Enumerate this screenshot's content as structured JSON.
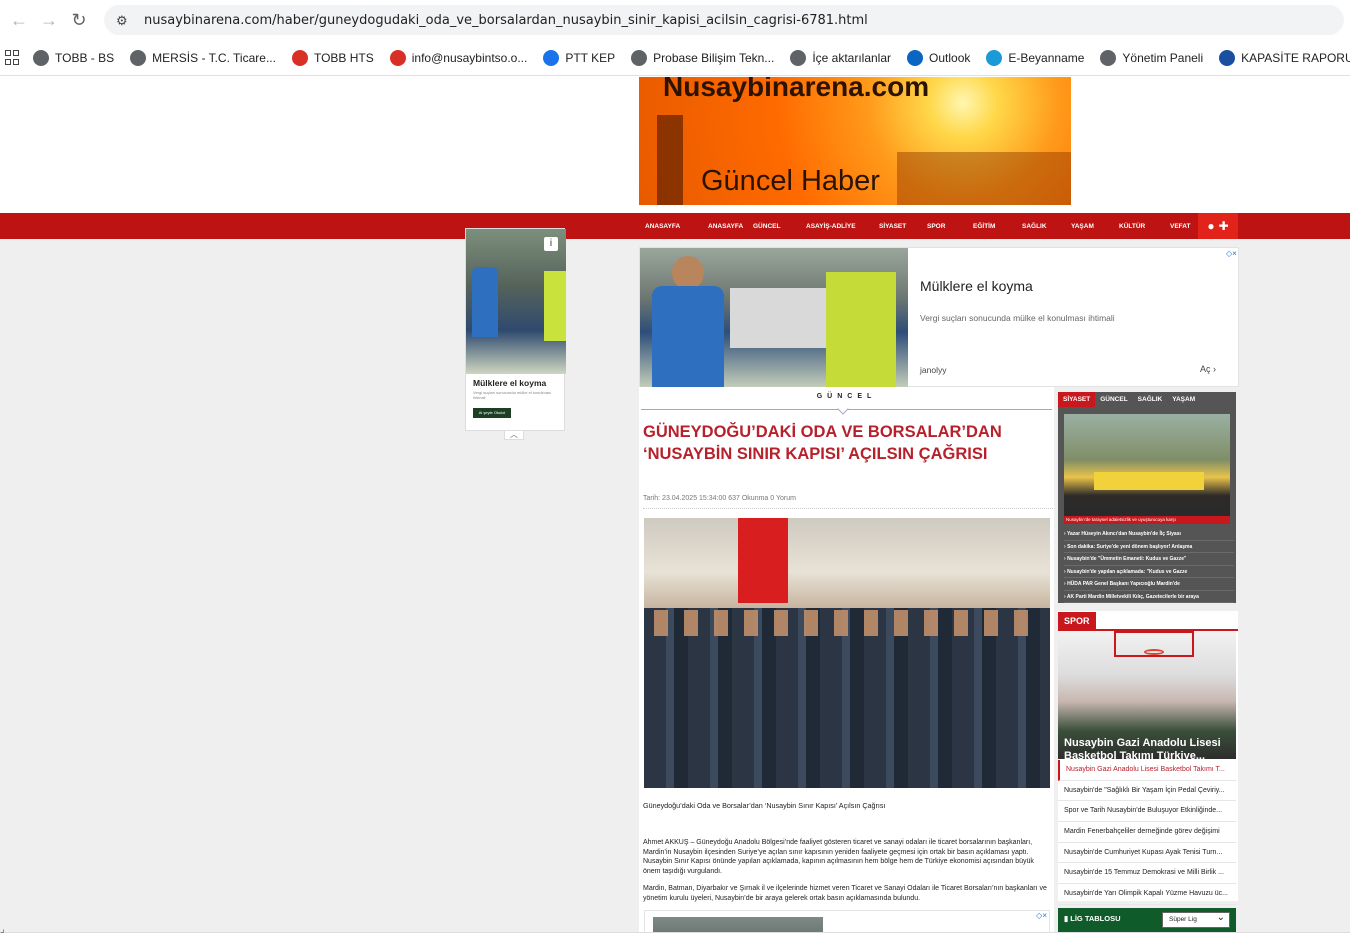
{
  "browser": {
    "url": "nusaybinarena.com/haber/guneydogudaki_oda_ve_borsalardan_nusaybin_sinir_kapisi_acilsin_cagrisi-6781.html",
    "bookmarks": [
      {
        "label": "TOBB - BS",
        "icon": "globe-icon",
        "color": "#5f6368"
      },
      {
        "label": "MERSİS - T.C. Ticare...",
        "icon": "globe-icon",
        "color": "#5f6368"
      },
      {
        "label": "TOBB HTS",
        "icon": "tobb-icon",
        "color": "#d93025"
      },
      {
        "label": "info@nusaybintso.o...",
        "icon": "mail-icon",
        "color": "#d93025"
      },
      {
        "label": "PTT KEP",
        "icon": "kep-icon",
        "color": "#1a73e8"
      },
      {
        "label": "Probase Bilişim Tekn...",
        "icon": "globe-icon",
        "color": "#5f6368"
      },
      {
        "label": "İçe aktarılanlar",
        "icon": "folder-icon",
        "color": "#5f6368"
      },
      {
        "label": "Outlook",
        "icon": "outlook-icon",
        "color": "#0a66c2"
      },
      {
        "label": "E-Beyanname",
        "icon": "ebeyan-icon",
        "color": "#1a9ad6"
      },
      {
        "label": "Yönetim Paneli",
        "icon": "globe-icon",
        "color": "#5f6368"
      },
      {
        "label": "KAPASİTE RAPORU...",
        "icon": "kapasite-icon",
        "color": "#1a4fa0"
      }
    ]
  },
  "site": {
    "banner_title": "Nusaybinarena.com",
    "banner_subtitle": "Güncel Haber",
    "menu": [
      "ANASAYFA",
      "ANASAYFA",
      "GÜNCEL",
      "ASAYİŞ-ADLİYE",
      "SİYASET",
      "SPOR",
      "EĞİTİM",
      "SAĞLIK",
      "YAŞAM",
      "KÜLTÜR",
      "VEFAT"
    ]
  },
  "left_ad": {
    "title": "Mülklere el koyma",
    "desc": "Vergi suçları sonucunda mülke el konulması ihtimali",
    "button": "Al şeyle Okulol"
  },
  "top_ad": {
    "title": "Mülklere el koyma",
    "desc": "Vergi suçları sonucunda mülke el konulması ihtimali",
    "domain": "janolyy",
    "open": "Aç"
  },
  "article": {
    "category": "GÜNCEL",
    "headline": "GÜNEYDOĞU’DAKİ ODA VE BORSALAR’DAN ‘NUSAYBİN SINIR KAPISI’ AÇILSIN ÇAĞRISI",
    "meta": "Tarih: 23.04.2025 15:34:00 637 Okunma 0 Yorum",
    "caption": "Güneydoğu’daki Oda ve Borsalar’dan ‘Nusaybin Sınır Kapısı’ Açılsın Çağrısı",
    "body1": "Ahmet AKKUŞ – Güneydoğu Anadolu Bölgesi’nde faaliyet gösteren ticaret ve sanayi odaları ile ticaret borsalarının başkanları, Mardin’in Nusaybin ilçesinden Suriye’ye açılan sınır kapısının yeniden faaliyete geçmesi için ortak bir basın açıklaması yaptı. Nusaybin Sınır Kapısı önünde yapılan açıklamada, kapının açılmasının hem bölge hem de Türkiye ekonomisi açısından büyük önem taşıdığı vurgulandı.",
    "body2": "Mardin, Batman, Diyarbakır ve Şırnak il ve ilçelerinde hizmet veren Ticaret ve Sanayi Odaları ile Ticaret Borsaları’nın başkanları ve yönetim kurulu üyeleri, Nusaybin’de bir araya gelerek ortak basın açıklamasında bulundu."
  },
  "right_tabs": {
    "tabs": [
      "SİYASET",
      "GÜNCEL",
      "SAĞLIK",
      "YAŞAM"
    ],
    "caption": "Nusaybin'de taraysel adaletsizlik ve uyuşturucuya karşı",
    "items": [
      "Yazar Hüseyin Akıncı'dan Nusaybin'de İlç Siyası",
      "Son dakika: Suriye'de yeni dönem başlıyor! Anlaşma",
      "Nusaybin'de \"Ümmetin Emaneti: Kudus ve Gazze\"",
      "Nusaybin'de yapılan açıklamada: \"Kudus ve Gazze",
      "HÜDA PAR Genel Başkanı Yapıcıoğlu Mardin'de",
      "AK Parti Mardin Milletvekili Kılıç, Gazetecilerle bir araya"
    ]
  },
  "spor": {
    "header": "SPOR",
    "image_title": "Nusaybin Gazi Anadolu Lisesi Basketbol Takımı Türkiye...",
    "items": [
      "Nusaybin Gazi Anadolu Lisesi Basketbol Takımı T...",
      "Nusaybin'de \"Sağlıklı Bir Yaşam İçin Pedal Çeviriy...",
      "Spor ve Tarih Nusaybin'de Buluşuyor Etkinliğinde...",
      "Mardin Fenerbahçeliler derneğinde görev değişimi",
      "Nusaybin'de Cumhuriyet Kupası Ayak Tenisi Turn...",
      "Nusaybin'de 15 Temmuz Demokrasi ve Milli Birlik ...",
      "Nusaybin'de Yarı Olimpik Kapalı Yüzme Havuzu üc..."
    ]
  },
  "lig": {
    "title": "LİG TABLOSU",
    "select": "Süper Lig"
  }
}
